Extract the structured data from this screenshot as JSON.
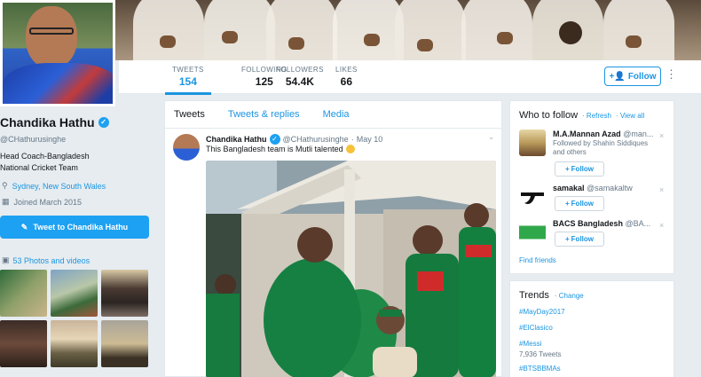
{
  "colors": {
    "accent": "#1da1f2",
    "link": "#1b95e0",
    "muted": "#657786",
    "background": "#e6ecf0"
  },
  "profile": {
    "name": "Chandika Hathu",
    "handle": "@CHathurusinghe",
    "bio": "Head Coach-Bangladesh National Cricket Team",
    "location": "Sydney, New South Wales",
    "joined": "Joined March 2015",
    "tweet_to_label": "Tweet to Chandika Hathu",
    "photos_label": "53 Photos and videos"
  },
  "stats": [
    {
      "label": "TWEETS",
      "value": "154",
      "active": true
    },
    {
      "label": "FOLLOWING",
      "value": "125"
    },
    {
      "label": "FOLLOWERS",
      "value": "54.4K"
    },
    {
      "label": "LIKES",
      "value": "66"
    }
  ],
  "header": {
    "follow_label": "Follow",
    "more_icon": "more-dots-icon"
  },
  "timeline": {
    "tabs": [
      "Tweets",
      "Tweets & replies",
      "Media"
    ],
    "tweet": {
      "name": "Chandika Hathu",
      "handle": "@CHathurusinghe",
      "separator": "·",
      "date": "May 10",
      "text": "This Bangladesh team is Mutli talented"
    }
  },
  "who_to_follow": {
    "title": "Who to follow",
    "refresh": "· Refresh",
    "view_all": "· View all",
    "suggestions": [
      {
        "name": "M.A.Mannan Azad",
        "handle": "@man...",
        "context": "Followed by Shahin Siddiques and others",
        "follow_label": "Follow"
      },
      {
        "name": "samakal",
        "handle": "@samakaltw",
        "context": "",
        "follow_label": "Follow"
      },
      {
        "name": "BACS Bangladesh",
        "handle": "@BA...",
        "context": "",
        "follow_label": "Follow"
      }
    ],
    "find_friends": "Find friends"
  },
  "trends": {
    "title": "Trends",
    "change": "· Change",
    "items": [
      {
        "tag": "#MayDay2017"
      },
      {
        "tag": "#ElClasico"
      },
      {
        "tag": "#Messi",
        "sub": "7,936 Tweets"
      },
      {
        "tag": "#BTSBBMAs"
      }
    ]
  }
}
